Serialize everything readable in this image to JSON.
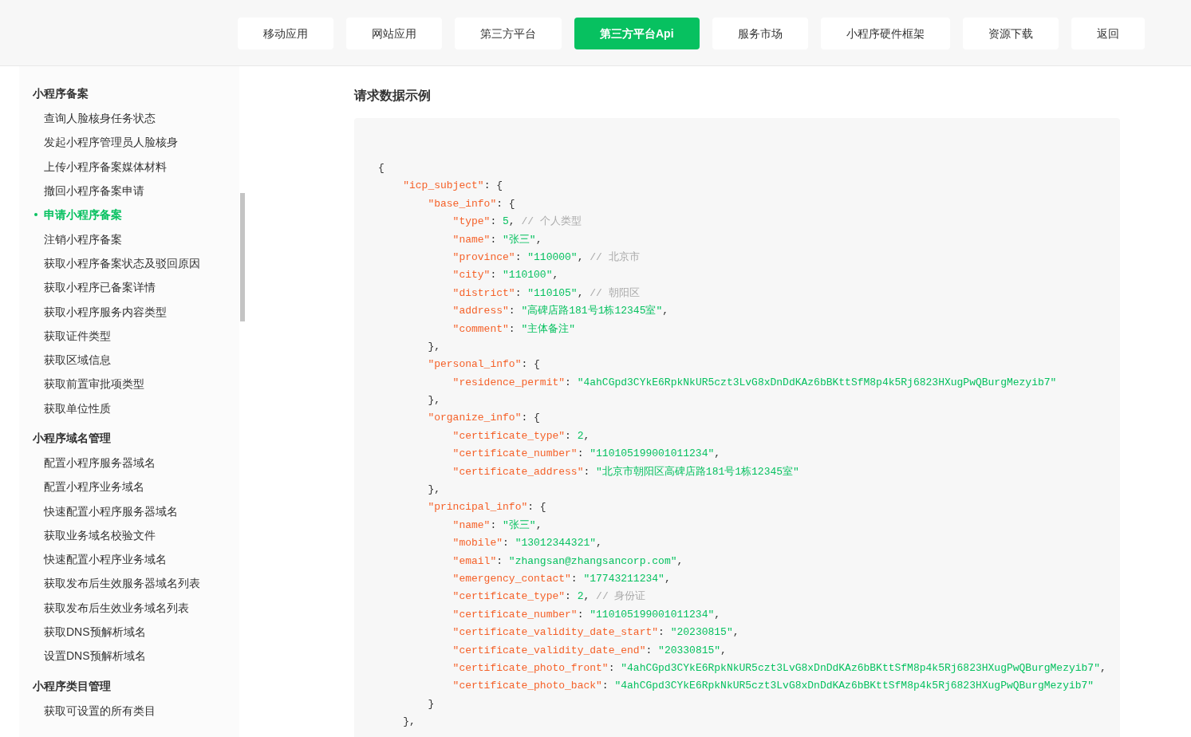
{
  "nav": [
    {
      "label": "移动应用",
      "selected": false
    },
    {
      "label": "网站应用",
      "selected": false
    },
    {
      "label": "第三方平台",
      "selected": false
    },
    {
      "label": "第三方平台Api",
      "selected": true
    },
    {
      "label": "服务市场",
      "selected": false
    },
    {
      "label": "小程序硬件框架",
      "selected": false
    },
    {
      "label": "资源下载",
      "selected": false
    },
    {
      "label": "返回",
      "selected": false
    }
  ],
  "sidebar": {
    "groups": [
      {
        "title": "小程序备案",
        "items": [
          {
            "label": "查询人脸核身任务状态",
            "selected": false
          },
          {
            "label": "发起小程序管理员人脸核身",
            "selected": false
          },
          {
            "label": "上传小程序备案媒体材料",
            "selected": false
          },
          {
            "label": "撤回小程序备案申请",
            "selected": false
          },
          {
            "label": "申请小程序备案",
            "selected": true
          },
          {
            "label": "注销小程序备案",
            "selected": false
          },
          {
            "label": "获取小程序备案状态及驳回原因",
            "selected": false
          },
          {
            "label": "获取小程序已备案详情",
            "selected": false
          },
          {
            "label": "获取小程序服务内容类型",
            "selected": false
          },
          {
            "label": "获取证件类型",
            "selected": false
          },
          {
            "label": "获取区域信息",
            "selected": false
          },
          {
            "label": "获取前置审批项类型",
            "selected": false
          },
          {
            "label": "获取单位性质",
            "selected": false
          }
        ]
      },
      {
        "title": "小程序域名管理",
        "items": [
          {
            "label": "配置小程序服务器域名",
            "selected": false
          },
          {
            "label": "配置小程序业务域名",
            "selected": false
          },
          {
            "label": "快速配置小程序服务器域名",
            "selected": false
          },
          {
            "label": "获取业务域名校验文件",
            "selected": false
          },
          {
            "label": "快速配置小程序业务域名",
            "selected": false
          },
          {
            "label": "获取发布后生效服务器域名列表",
            "selected": false
          },
          {
            "label": "获取发布后生效业务域名列表",
            "selected": false
          },
          {
            "label": "获取DNS预解析域名",
            "selected": false
          },
          {
            "label": "设置DNS预解析域名",
            "selected": false
          }
        ]
      },
      {
        "title": "小程序类目管理",
        "items": [
          {
            "label": "获取可设置的所有类目",
            "selected": false
          }
        ]
      }
    ]
  },
  "content": {
    "heading": "请求数据示例",
    "code_lines": [
      [
        {
          "kind": "punct",
          "text": "{"
        }
      ],
      [
        {
          "kind": "key",
          "text": "    \"icp_subject\""
        },
        {
          "kind": "punct",
          "text": ": {"
        }
      ],
      [
        {
          "kind": "key",
          "text": "        \"base_info\""
        },
        {
          "kind": "punct",
          "text": ": {"
        }
      ],
      [
        {
          "kind": "key",
          "text": "            \"type\""
        },
        {
          "kind": "punct",
          "text": ": "
        },
        {
          "kind": "value",
          "text": "5"
        },
        {
          "kind": "punct",
          "text": ", "
        },
        {
          "kind": "comment",
          "text": "// 个人类型"
        }
      ],
      [
        {
          "kind": "key",
          "text": "            \"name\""
        },
        {
          "kind": "punct",
          "text": ": "
        },
        {
          "kind": "value",
          "text": "\"张三\""
        },
        {
          "kind": "punct",
          "text": ","
        }
      ],
      [
        {
          "kind": "key",
          "text": "            \"province\""
        },
        {
          "kind": "punct",
          "text": ": "
        },
        {
          "kind": "value",
          "text": "\"110000\""
        },
        {
          "kind": "punct",
          "text": ", "
        },
        {
          "kind": "comment",
          "text": "// 北京市"
        }
      ],
      [
        {
          "kind": "key",
          "text": "            \"city\""
        },
        {
          "kind": "punct",
          "text": ": "
        },
        {
          "kind": "value",
          "text": "\"110100\""
        },
        {
          "kind": "punct",
          "text": ","
        }
      ],
      [
        {
          "kind": "key",
          "text": "            \"district\""
        },
        {
          "kind": "punct",
          "text": ": "
        },
        {
          "kind": "value",
          "text": "\"110105\""
        },
        {
          "kind": "punct",
          "text": ", "
        },
        {
          "kind": "comment",
          "text": "// 朝阳区"
        }
      ],
      [
        {
          "kind": "key",
          "text": "            \"address\""
        },
        {
          "kind": "punct",
          "text": ": "
        },
        {
          "kind": "value",
          "text": "\"高碑店路181号1栋12345室\""
        },
        {
          "kind": "punct",
          "text": ","
        }
      ],
      [
        {
          "kind": "key",
          "text": "            \"comment\""
        },
        {
          "kind": "punct",
          "text": ": "
        },
        {
          "kind": "value",
          "text": "\"主体备注\""
        }
      ],
      [
        {
          "kind": "punct",
          "text": "        },"
        }
      ],
      [
        {
          "kind": "key",
          "text": "        \"personal_info\""
        },
        {
          "kind": "punct",
          "text": ": {"
        }
      ],
      [
        {
          "kind": "key",
          "text": "            \"residence_permit\""
        },
        {
          "kind": "punct",
          "text": ": "
        },
        {
          "kind": "value",
          "text": "\"4ahCGpd3CYkE6RpkNkUR5czt3LvG8xDnDdKAz6bBKttSfM8p4k5Rj6823HXugPwQBurgMezyib7\""
        }
      ],
      [
        {
          "kind": "punct",
          "text": "        },"
        }
      ],
      [
        {
          "kind": "key",
          "text": "        \"organize_info\""
        },
        {
          "kind": "punct",
          "text": ": {"
        }
      ],
      [
        {
          "kind": "key",
          "text": "            \"certificate_type\""
        },
        {
          "kind": "punct",
          "text": ": "
        },
        {
          "kind": "value",
          "text": "2"
        },
        {
          "kind": "punct",
          "text": ","
        }
      ],
      [
        {
          "kind": "key",
          "text": "            \"certificate_number\""
        },
        {
          "kind": "punct",
          "text": ": "
        },
        {
          "kind": "value",
          "text": "\"110105199001011234\""
        },
        {
          "kind": "punct",
          "text": ","
        }
      ],
      [
        {
          "kind": "key",
          "text": "            \"certificate_address\""
        },
        {
          "kind": "punct",
          "text": ": "
        },
        {
          "kind": "value",
          "text": "\"北京市朝阳区高碑店路181号1栋12345室\""
        }
      ],
      [
        {
          "kind": "punct",
          "text": "        },"
        }
      ],
      [
        {
          "kind": "key",
          "text": "        \"principal_info\""
        },
        {
          "kind": "punct",
          "text": ": {"
        }
      ],
      [
        {
          "kind": "key",
          "text": "            \"name\""
        },
        {
          "kind": "punct",
          "text": ": "
        },
        {
          "kind": "value",
          "text": "\"张三\""
        },
        {
          "kind": "punct",
          "text": ","
        }
      ],
      [
        {
          "kind": "key",
          "text": "            \"mobile\""
        },
        {
          "kind": "punct",
          "text": ": "
        },
        {
          "kind": "value",
          "text": "\"13012344321\""
        },
        {
          "kind": "punct",
          "text": ","
        }
      ],
      [
        {
          "kind": "key",
          "text": "            \"email\""
        },
        {
          "kind": "punct",
          "text": ": "
        },
        {
          "kind": "value",
          "text": "\"zhangsan@zhangsancorp.com\""
        },
        {
          "kind": "punct",
          "text": ","
        }
      ],
      [
        {
          "kind": "key",
          "text": "            \"emergency_contact\""
        },
        {
          "kind": "punct",
          "text": ": "
        },
        {
          "kind": "value",
          "text": "\"17743211234\""
        },
        {
          "kind": "punct",
          "text": ","
        }
      ],
      [
        {
          "kind": "key",
          "text": "            \"certificate_type\""
        },
        {
          "kind": "punct",
          "text": ": "
        },
        {
          "kind": "value",
          "text": "2"
        },
        {
          "kind": "punct",
          "text": ", "
        },
        {
          "kind": "comment",
          "text": "// 身份证"
        }
      ],
      [
        {
          "kind": "key",
          "text": "            \"certificate_number\""
        },
        {
          "kind": "punct",
          "text": ": "
        },
        {
          "kind": "value",
          "text": "\"110105199001011234\""
        },
        {
          "kind": "punct",
          "text": ","
        }
      ],
      [
        {
          "kind": "key",
          "text": "            \"certificate_validity_date_start\""
        },
        {
          "kind": "punct",
          "text": ": "
        },
        {
          "kind": "value",
          "text": "\"20230815\""
        },
        {
          "kind": "punct",
          "text": ","
        }
      ],
      [
        {
          "kind": "key",
          "text": "            \"certificate_validity_date_end\""
        },
        {
          "kind": "punct",
          "text": ": "
        },
        {
          "kind": "value",
          "text": "\"20330815\""
        },
        {
          "kind": "punct",
          "text": ","
        }
      ],
      [
        {
          "kind": "key",
          "text": "            \"certificate_photo_front\""
        },
        {
          "kind": "punct",
          "text": ": "
        },
        {
          "kind": "value",
          "text": "\"4ahCGpd3CYkE6RpkNkUR5czt3LvG8xDnDdKAz6bBKttSfM8p4k5Rj6823HXugPwQBurgMezyib7\""
        },
        {
          "kind": "punct",
          "text": ","
        }
      ],
      [
        {
          "kind": "key",
          "text": "            \"certificate_photo_back\""
        },
        {
          "kind": "punct",
          "text": ": "
        },
        {
          "kind": "value",
          "text": "\"4ahCGpd3CYkE6RpkNkUR5czt3LvG8xDnDdKAz6bBKttSfM8p4k5Rj6823HXugPwQBurgMezyib7\""
        }
      ],
      [
        {
          "kind": "punct",
          "text": "        }"
        }
      ],
      [
        {
          "kind": "punct",
          "text": "    },"
        }
      ]
    ]
  }
}
